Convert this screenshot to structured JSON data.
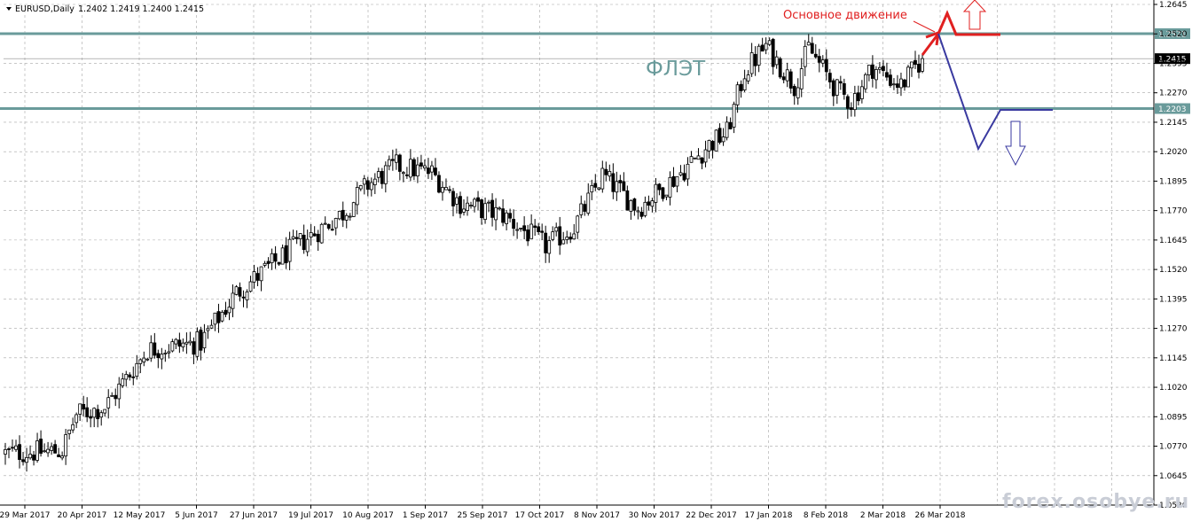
{
  "header": {
    "symbol_label": "EURUSD,Daily",
    "ohlc": "1.2402 1.2419 1.2400 1.2415"
  },
  "annotations": {
    "flat_label": "ФЛЭТ",
    "main_move_label": "Основное движение",
    "watermark": "forex.osobye.ru"
  },
  "chart_data": {
    "type": "candlestick",
    "symbol": "EURUSD",
    "timeframe": "Daily",
    "last_close": 1.2415,
    "ylim": [
      1.052,
      1.2645
    ],
    "y_ticks": [
      "1.2645",
      "1.2520",
      "1.2395",
      "1.2270",
      "1.2145",
      "1.2020",
      "1.1895",
      "1.1770",
      "1.1645",
      "1.1520",
      "1.1395",
      "1.1270",
      "1.1145",
      "1.1020",
      "1.0895",
      "1.0770",
      "1.0645",
      "1.0520"
    ],
    "x_ticks": [
      "29 Mar 2017",
      "20 Apr 2017",
      "12 May 2017",
      "5 Jun 2017",
      "27 Jun 2017",
      "19 Jul 2017",
      "10 Aug 2017",
      "1 Sep 2017",
      "25 Sep 2017",
      "17 Oct 2017",
      "8 Nov 2017",
      "30 Nov 2017",
      "22 Dec 2017",
      "17 Jan 2018",
      "8 Feb 2018",
      "2 Mar 2018",
      "26 Mar 2018"
    ],
    "levels": [
      {
        "label": "1.2521",
        "value": 1.2521
      },
      {
        "label": "1.2203",
        "value": 1.2203
      }
    ],
    "price_marker": {
      "label": "1.2415",
      "value": 1.2415
    },
    "trend_path": [
      [
        0,
        1.074
      ],
      [
        16,
        1.075
      ],
      [
        20,
        1.0905
      ],
      [
        28,
        1.0935
      ],
      [
        40,
        1.118
      ],
      [
        55,
        1.121
      ],
      [
        65,
        1.142
      ],
      [
        80,
        1.16
      ],
      [
        95,
        1.176
      ],
      [
        102,
        1.188
      ],
      [
        110,
        1.196
      ],
      [
        120,
        1.193
      ],
      [
        128,
        1.18
      ],
      [
        140,
        1.175
      ],
      [
        152,
        1.162
      ],
      [
        160,
        1.17
      ],
      [
        168,
        1.192
      ],
      [
        178,
        1.178
      ],
      [
        190,
        1.193
      ],
      [
        198,
        1.205
      ],
      [
        203,
        1.21
      ],
      [
        208,
        1.236
      ],
      [
        214,
        1.247
      ],
      [
        222,
        1.23
      ],
      [
        226,
        1.246
      ],
      [
        234,
        1.228
      ],
      [
        238,
        1.223
      ],
      [
        244,
        1.238
      ],
      [
        252,
        1.23
      ],
      [
        258,
        1.2415
      ]
    ],
    "colors": {
      "candle": "#000000",
      "level_line": "#6a9b9b",
      "main_move": "#e02020",
      "scenario": "#3a3aa0"
    }
  }
}
